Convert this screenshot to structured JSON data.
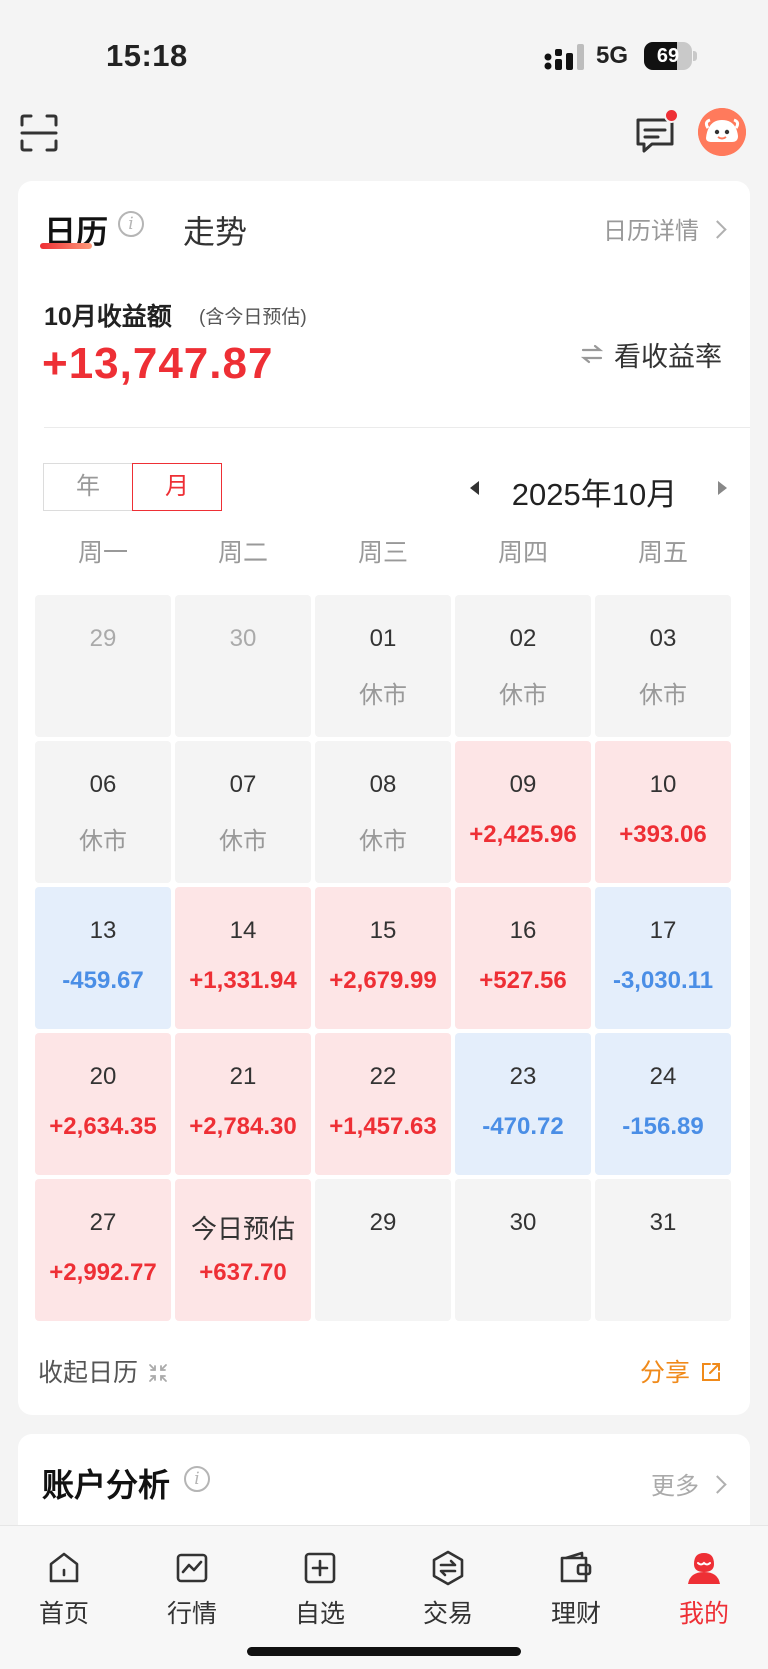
{
  "status_bar": {
    "time": "15:18",
    "network": "5G",
    "battery": "69",
    "battery_level": 0.69
  },
  "header": {
    "scan_icon": "scan-icon",
    "message_icon": "message-icon",
    "avatar_icon": "avatar-icon"
  },
  "tabs": {
    "calendar": "日历",
    "trend": "走势",
    "calendar_detail": "日历详情"
  },
  "income": {
    "label": "10月收益额",
    "note": "(含今日预估)",
    "value": "+13,747.87",
    "toggle": "看收益率"
  },
  "view_mode": {
    "year": "年",
    "month": "月",
    "selected": "月"
  },
  "month_title": "2025年10月",
  "weekdays": [
    "周一",
    "周二",
    "周三",
    "周四",
    "周五"
  ],
  "cells": [
    {
      "d": "29",
      "v": "",
      "t": "faded"
    },
    {
      "d": "30",
      "v": "",
      "t": "faded"
    },
    {
      "d": "01",
      "v": "休市",
      "t": "closed"
    },
    {
      "d": "02",
      "v": "休市",
      "t": "closed"
    },
    {
      "d": "03",
      "v": "休市",
      "t": "closed"
    },
    {
      "d": "06",
      "v": "休市",
      "t": "closed"
    },
    {
      "d": "07",
      "v": "休市",
      "t": "closed"
    },
    {
      "d": "08",
      "v": "休市",
      "t": "closed"
    },
    {
      "d": "09",
      "v": "+2,425.96",
      "t": "pos"
    },
    {
      "d": "10",
      "v": "+393.06",
      "t": "pos"
    },
    {
      "d": "13",
      "v": "-459.67",
      "t": "neg"
    },
    {
      "d": "14",
      "v": "+1,331.94",
      "t": "pos"
    },
    {
      "d": "15",
      "v": "+2,679.99",
      "t": "pos"
    },
    {
      "d": "16",
      "v": "+527.56",
      "t": "pos"
    },
    {
      "d": "17",
      "v": "-3,030.11",
      "t": "neg"
    },
    {
      "d": "20",
      "v": "+2,634.35",
      "t": "pos"
    },
    {
      "d": "21",
      "v": "+2,784.30",
      "t": "pos"
    },
    {
      "d": "22",
      "v": "+1,457.63",
      "t": "pos"
    },
    {
      "d": "23",
      "v": "-470.72",
      "t": "neg"
    },
    {
      "d": "24",
      "v": "-156.89",
      "t": "neg"
    },
    {
      "d": "27",
      "v": "+2,992.77",
      "t": "pos"
    },
    {
      "d": "今日预估",
      "v": "+637.70",
      "t": "pos today"
    },
    {
      "d": "29",
      "v": "",
      "t": "empty"
    },
    {
      "d": "30",
      "v": "",
      "t": "empty"
    },
    {
      "d": "31",
      "v": "",
      "t": "empty"
    }
  ],
  "footer": {
    "collapse": "收起日历",
    "share": "分享"
  },
  "account": {
    "title": "账户分析",
    "more": "更多"
  },
  "bottom_nav": [
    {
      "label": "首页",
      "icon": "home-icon"
    },
    {
      "label": "行情",
      "icon": "market-icon"
    },
    {
      "label": "自选",
      "icon": "watchlist-icon"
    },
    {
      "label": "交易",
      "icon": "trade-icon"
    },
    {
      "label": "理财",
      "icon": "wallet-icon"
    },
    {
      "label": "我的",
      "icon": "profile-icon"
    }
  ],
  "bottom_nav_active": "我的",
  "colors": {
    "accent": "#ee2f35",
    "positive_bg": "#fde5e6",
    "negative_bg": "#e4eefb",
    "negative_text": "#4a8ee6",
    "share": "#f08a1a"
  }
}
